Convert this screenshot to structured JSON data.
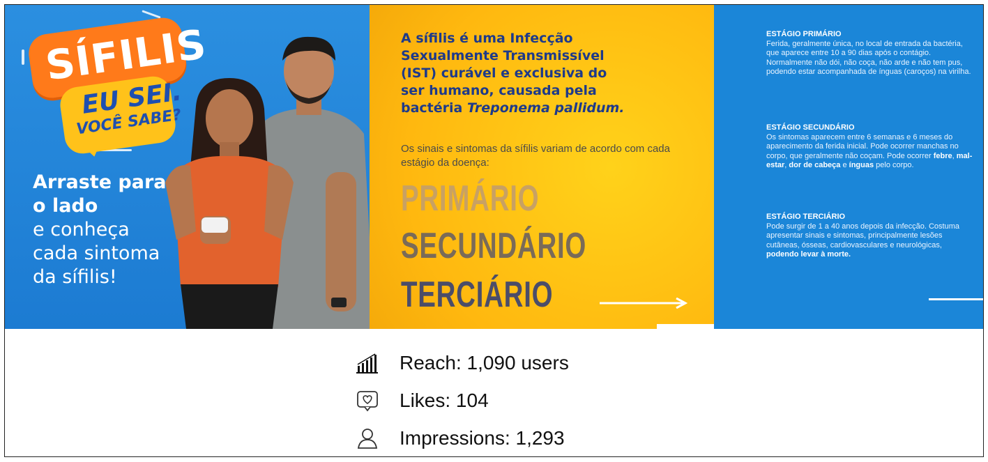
{
  "panel1": {
    "badge_title": "SÍFILIS",
    "badge_line1": "EU SEI.",
    "badge_line2": "VOCÊ SABE?",
    "cta_bold_1": "Arraste para",
    "cta_bold_2": "o lado",
    "cta_line_1": "e conheça",
    "cta_line_2": "cada sintoma",
    "cta_line_3": "da sífilis!"
  },
  "panel2": {
    "lead_1": "A sífilis é uma Infecção",
    "lead_2": "Sexualmente Transmissível",
    "lead_3": "(IST) curável e exclusiva do",
    "lead_4": "ser humano, causada pela",
    "lead_5a": "bactéria ",
    "lead_5b": "Treponema pallidum.",
    "sub": "Os sinais e sintomas da sífilis variam de acordo com cada estágio da doença:",
    "stage_1": "PRIMÁRIO",
    "stage_2": "SECUNDÁRIO",
    "stage_3": "TERCIÁRIO"
  },
  "panel3": {
    "primary_title": "ESTÁGIO PRIMÁRIO",
    "primary_text": "Ferida, geralmente única, no local de entrada da bactéria, que aparece entre 10 a 90 dias após o contágio. Normalmente não dói, não coça, não arde e não tem pus, podendo estar acompanhada de ínguas (caroços) na virilha.",
    "secondary_title": "ESTÁGIO SECUNDÁRIO",
    "secondary_text": "Os sintomas aparecem entre 6 semanas e 6 meses do aparecimento da ferida inicial. Pode ocorrer manchas no corpo, que geralmente não coçam. Pode ocorrer ",
    "secondary_b1": "febre",
    "secondary_sep1": ", ",
    "secondary_b2": "mal-estar",
    "secondary_sep2": ", ",
    "secondary_b3": "dor de cabeça",
    "secondary_sep3": " e ",
    "secondary_b4": "ínguas",
    "secondary_end": " pelo corpo.",
    "tertiary_title": "ESTÁGIO TERCIÁRIO",
    "tertiary_text": "Pode surgir de 1 a 40 anos depois da infecção. Costuma apresentar sinais e sintomas, principalmente lesões cutâneas, ósseas, cardiovasculares e neurológicas,",
    "tertiary_bold": "podendo levar à morte."
  },
  "stats": {
    "reach": "Reach: 1,090 users",
    "likes": "Likes: 104",
    "impressions": "Impressions: 1,293"
  },
  "colors": {
    "blue": "#1c7bd2",
    "yellow": "#ffb80f",
    "orange": "#ff7a1a",
    "navy": "#1e3a8a"
  },
  "icons": [
    "bar-chart-icon",
    "heart-bubble-icon",
    "person-icon"
  ]
}
